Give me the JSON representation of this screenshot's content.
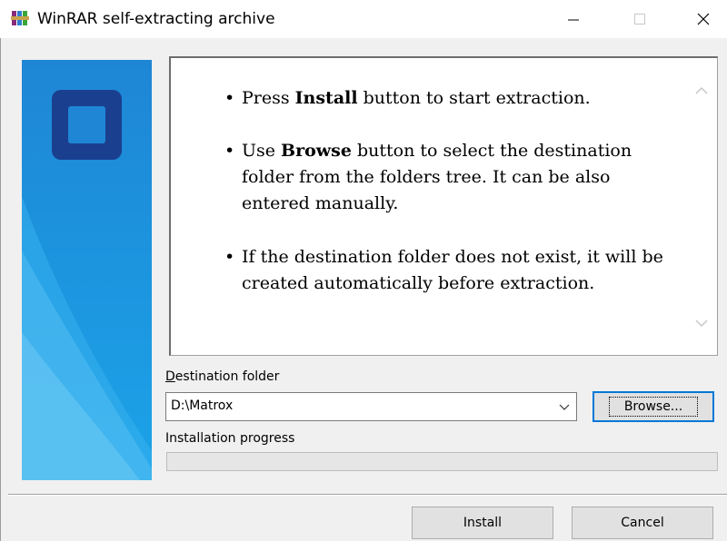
{
  "window": {
    "title": "WinRAR self-extracting archive",
    "icons": {
      "app": "winrar-books-icon",
      "minimize": "minimize-icon",
      "maximize": "maximize-icon",
      "close": "close-icon"
    }
  },
  "instructions": {
    "items": [
      {
        "before": "Press ",
        "bold": "Install",
        "after": " button to start extraction."
      },
      {
        "before": "Use ",
        "bold": "Browse",
        "after": " button to select the destination folder from the folders tree. It can be also entered manually."
      },
      {
        "before": "",
        "bold": "",
        "after": "If the destination folder does not exist, it will be created automatically before extraction."
      }
    ]
  },
  "destination": {
    "label_first": "D",
    "label_rest": "estination folder",
    "value": "D:\\Matrox",
    "browse_label": "Browse..."
  },
  "progress": {
    "label": "Installation progress",
    "value": 0
  },
  "buttons": {
    "install": "Install",
    "cancel": "Cancel"
  },
  "colors": {
    "banner_top": "#1e88d6",
    "banner_bottom": "#1aa2e6",
    "logo": "#1b3f8f",
    "focus_border": "#0078d7"
  }
}
